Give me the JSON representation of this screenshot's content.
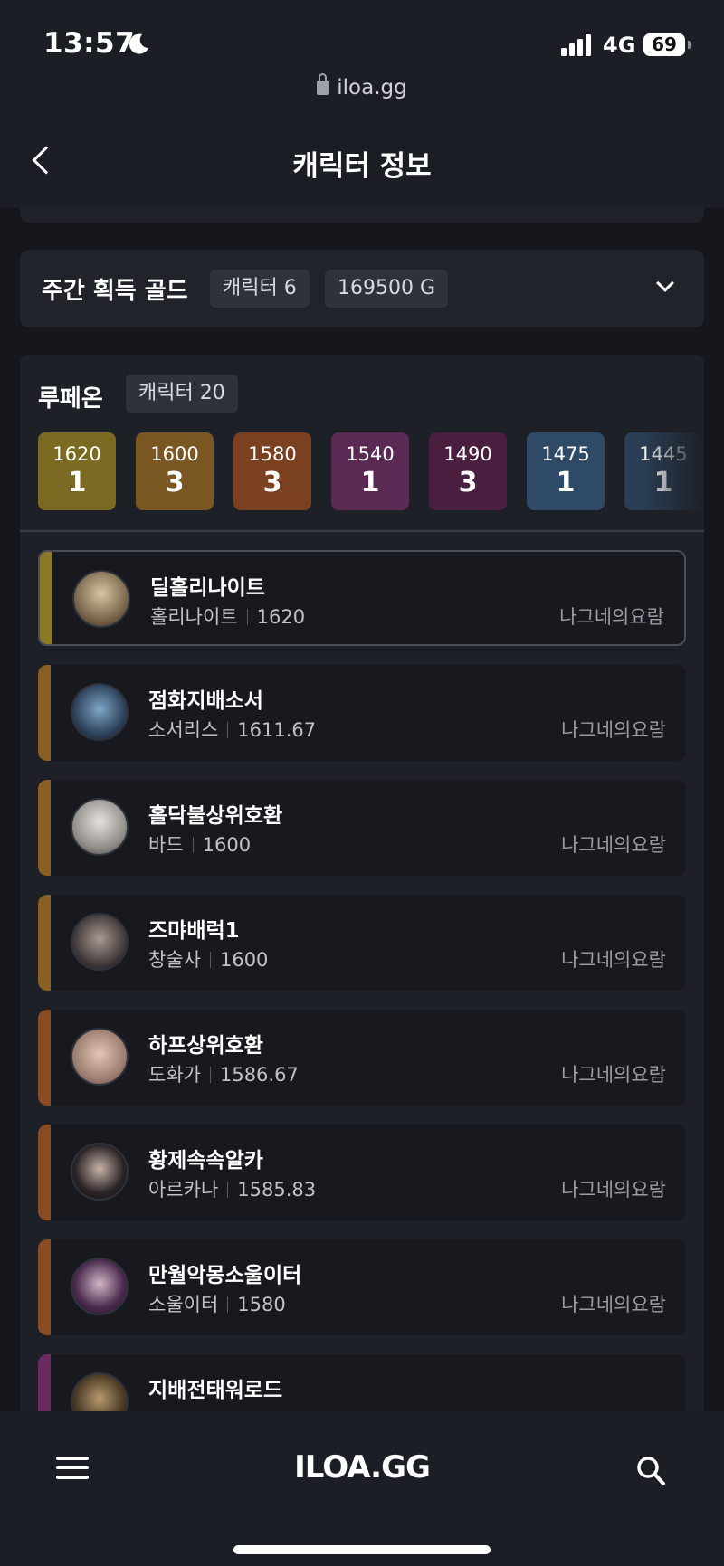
{
  "status": {
    "time": "13:57",
    "network": "4G",
    "battery": "69"
  },
  "browser": {
    "url": "iloa.gg"
  },
  "header": {
    "title": "캐릭터 정보"
  },
  "weekly_gold": {
    "title": "주간 획득 골드",
    "characters_chip": "캐릭터 6",
    "gold_chip": "169500 G"
  },
  "server_group": {
    "name": "루페온",
    "count_chip": "캐릭터 20",
    "levels": [
      {
        "level": "1620",
        "count": "1",
        "color": "#7a6a22"
      },
      {
        "level": "1600",
        "count": "3",
        "color": "#7a5722"
      },
      {
        "level": "1580",
        "count": "3",
        "color": "#7a4020"
      },
      {
        "level": "1540",
        "count": "1",
        "color": "#5a2a55"
      },
      {
        "level": "1490",
        "count": "3",
        "color": "#4a1e3e"
      },
      {
        "level": "1475",
        "count": "1",
        "color": "#2e4a66"
      },
      {
        "level": "1445",
        "count": "1",
        "color": "#2a3e55"
      }
    ]
  },
  "characters": [
    {
      "name": "딜홀리나이트",
      "class": "홀리나이트",
      "level": "1620",
      "server": "나그네의요람",
      "bar": "#8a7a25"
    },
    {
      "name": "점화지배소서",
      "class": "소서리스",
      "level": "1611.67",
      "server": "나그네의요람",
      "bar": "#8a5f22"
    },
    {
      "name": "홀닥불상위호환",
      "class": "바드",
      "level": "1600",
      "server": "나그네의요람",
      "bar": "#8a5f22"
    },
    {
      "name": "즈먀배럭1",
      "class": "창술사",
      "level": "1600",
      "server": "나그네의요람",
      "bar": "#8a5f22"
    },
    {
      "name": "하프상위호환",
      "class": "도화가",
      "level": "1586.67",
      "server": "나그네의요람",
      "bar": "#8a4a22"
    },
    {
      "name": "황제속속알카",
      "class": "아르카나",
      "level": "1585.83",
      "server": "나그네의요람",
      "bar": "#8a4a22"
    },
    {
      "name": "만월악몽소울이터",
      "class": "소울이터",
      "level": "1580",
      "server": "나그네의요람",
      "bar": "#8a4a22"
    },
    {
      "name": "지배전태워로드",
      "class": "",
      "level": "",
      "server": "",
      "bar": "#6a2a60"
    }
  ],
  "bottom_nav": {
    "logo": "ILOA.GG",
    "menu_icon": "menu-icon",
    "search_icon": "search-icon"
  }
}
